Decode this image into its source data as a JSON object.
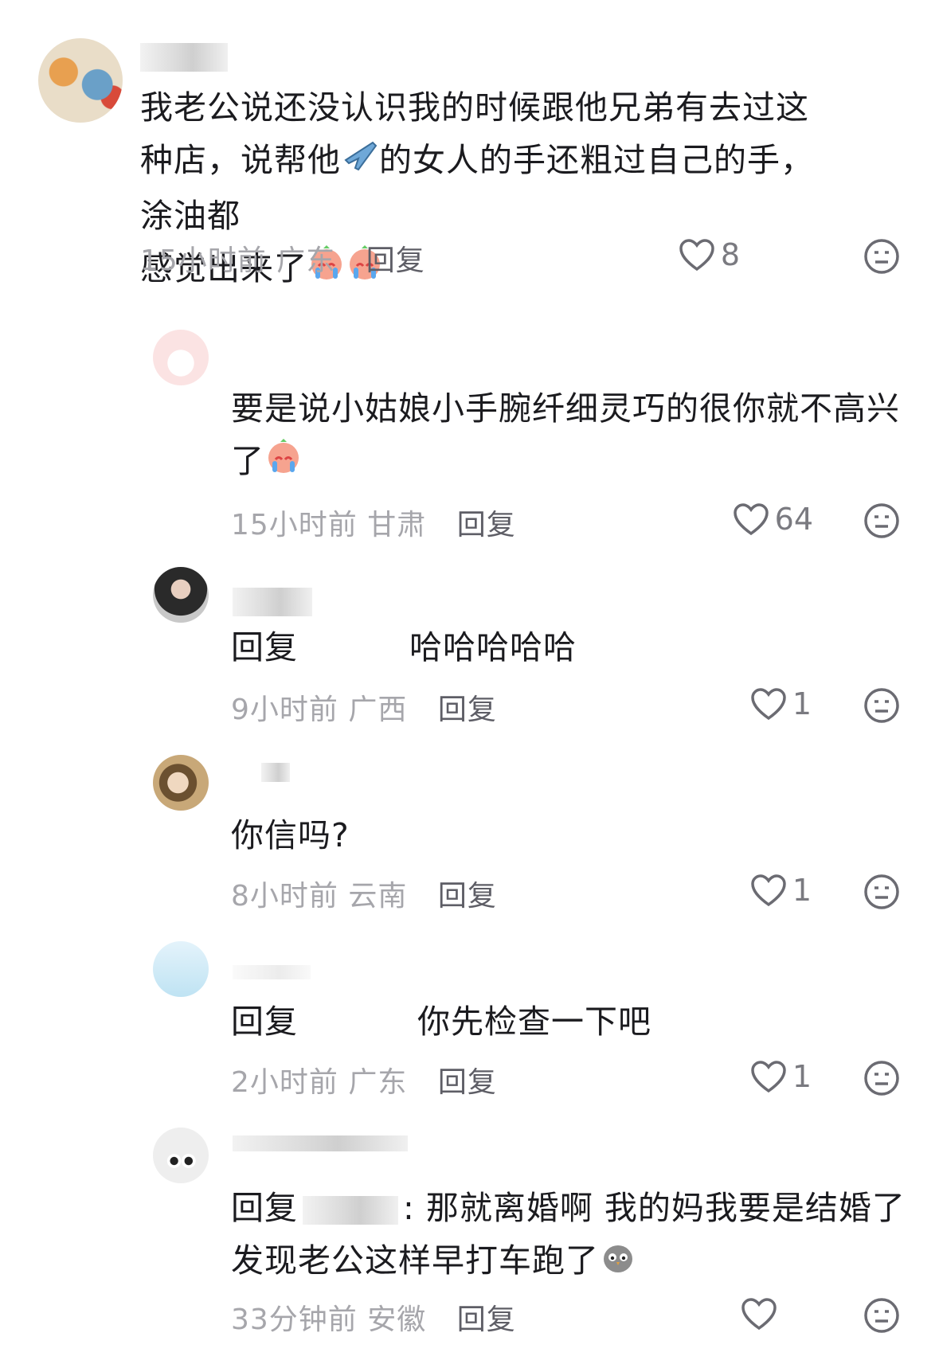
{
  "comments": [
    {
      "text": "我老公说还没认识我的时候跟他兄弟有去过这种店，说帮他",
      "text2": "的女人的手还粗过自己的手，涂油都",
      "text3": "感觉出来了",
      "time": "15小时前",
      "location": "广东",
      "reply": "回复",
      "likes": "8"
    },
    {
      "text": "要是说小姑娘小手腕纤细灵巧的很你就不高兴",
      "text2": "了",
      "time": "15小时前",
      "location": "甘肃",
      "reply": "回复",
      "likes": "64"
    },
    {
      "reply_prefix": "回复",
      "text": "哈哈哈哈哈",
      "time": "9小时前",
      "location": "广西",
      "reply": "回复",
      "likes": "1"
    },
    {
      "text": "你信吗?",
      "time": "8小时前",
      "location": "云南",
      "reply": "回复",
      "likes": "1"
    },
    {
      "reply_prefix": "回复",
      "text": "你先检查一下吧",
      "time": "2小时前",
      "location": "广东",
      "reply": "回复",
      "likes": "1"
    },
    {
      "reply_prefix": "回复",
      "text": ": 那就离婚啊 我的妈我要是结婚了",
      "text2": "发现老公这样早打车跑了",
      "time": "33分钟前",
      "location": "安徽",
      "reply": "回复",
      "likes": ""
    }
  ],
  "icons": {
    "like": "heart-outline-icon",
    "dislike": "neutral-face-icon"
  },
  "colors": {
    "text": "#1b1b1f",
    "meta": "#a6a6ab",
    "reply": "#5e5e66"
  }
}
